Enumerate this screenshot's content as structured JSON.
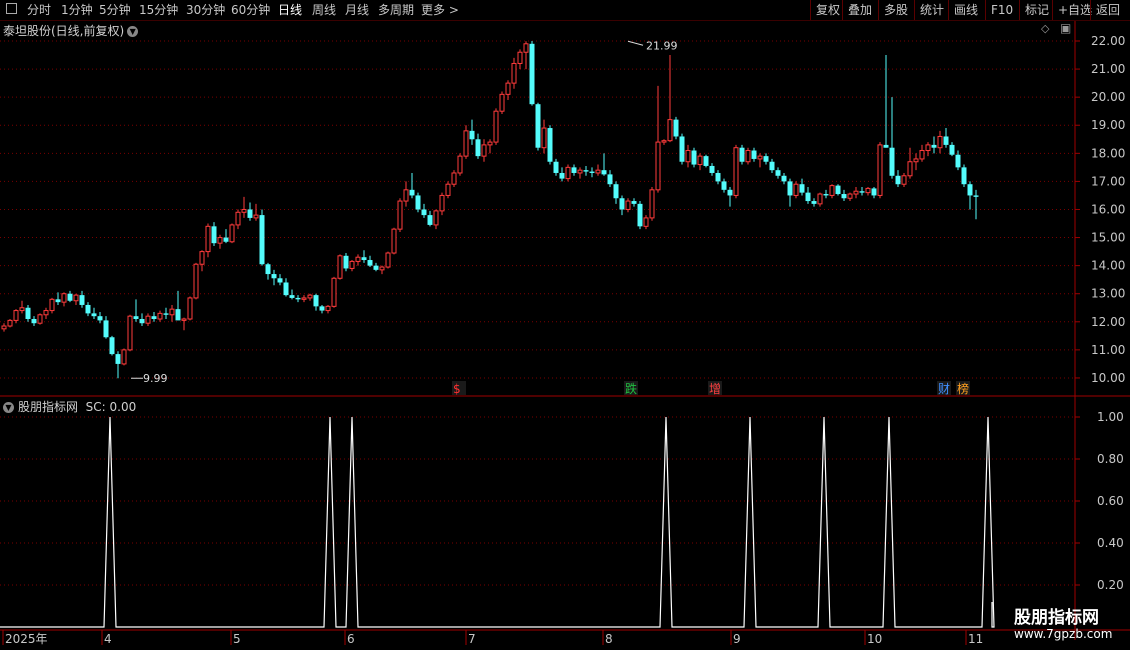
{
  "toolbar": {
    "periods": [
      "分时",
      "1分钟",
      "5分钟",
      "15分钟",
      "30分钟",
      "60分钟",
      "日线",
      "周线",
      "月线",
      "多周期",
      "更多 >"
    ],
    "active_period": "日线",
    "right_buttons": [
      "复权",
      "叠加",
      "多股",
      "统计",
      "画线",
      "F10",
      "标记",
      "+自选",
      "返回"
    ]
  },
  "stock": {
    "title": "泰坦股份(日线,前复权)"
  },
  "price_axis": {
    "ticks": [
      "22.00",
      "21.00",
      "20.00",
      "19.00",
      "18.00",
      "17.00",
      "16.00",
      "15.00",
      "14.00",
      "13.00",
      "12.00",
      "11.00",
      "10.00"
    ]
  },
  "annotations": {
    "high": "21.99",
    "low": "9.99"
  },
  "event_markers": [
    {
      "label": "$",
      "color": "#ff3030"
    },
    {
      "label": "跌",
      "color": "#20c040"
    },
    {
      "label": "增",
      "color": "#ff4040"
    },
    {
      "label": "财",
      "color": "#4090ff"
    },
    {
      "label": "榜",
      "color": "#ffa020"
    }
  ],
  "indicator": {
    "name": "股朋指标网",
    "value_text": "SC: 0.00",
    "ticks": [
      "1.00",
      "0.80",
      "0.60",
      "0.40",
      "0.20"
    ]
  },
  "date_axis": {
    "labels": [
      "2025年",
      "4",
      "5",
      "6",
      "7",
      "8",
      "9",
      "10",
      "11"
    ]
  },
  "watermark": {
    "title": "股朋指标网",
    "url": "www.7gpzb.com"
  },
  "colors": {
    "up": "#ff3b3b",
    "down": "#54fcfc",
    "grid": "#7a0000",
    "axis": "#a00000",
    "signal": "#ffffff"
  }
}
